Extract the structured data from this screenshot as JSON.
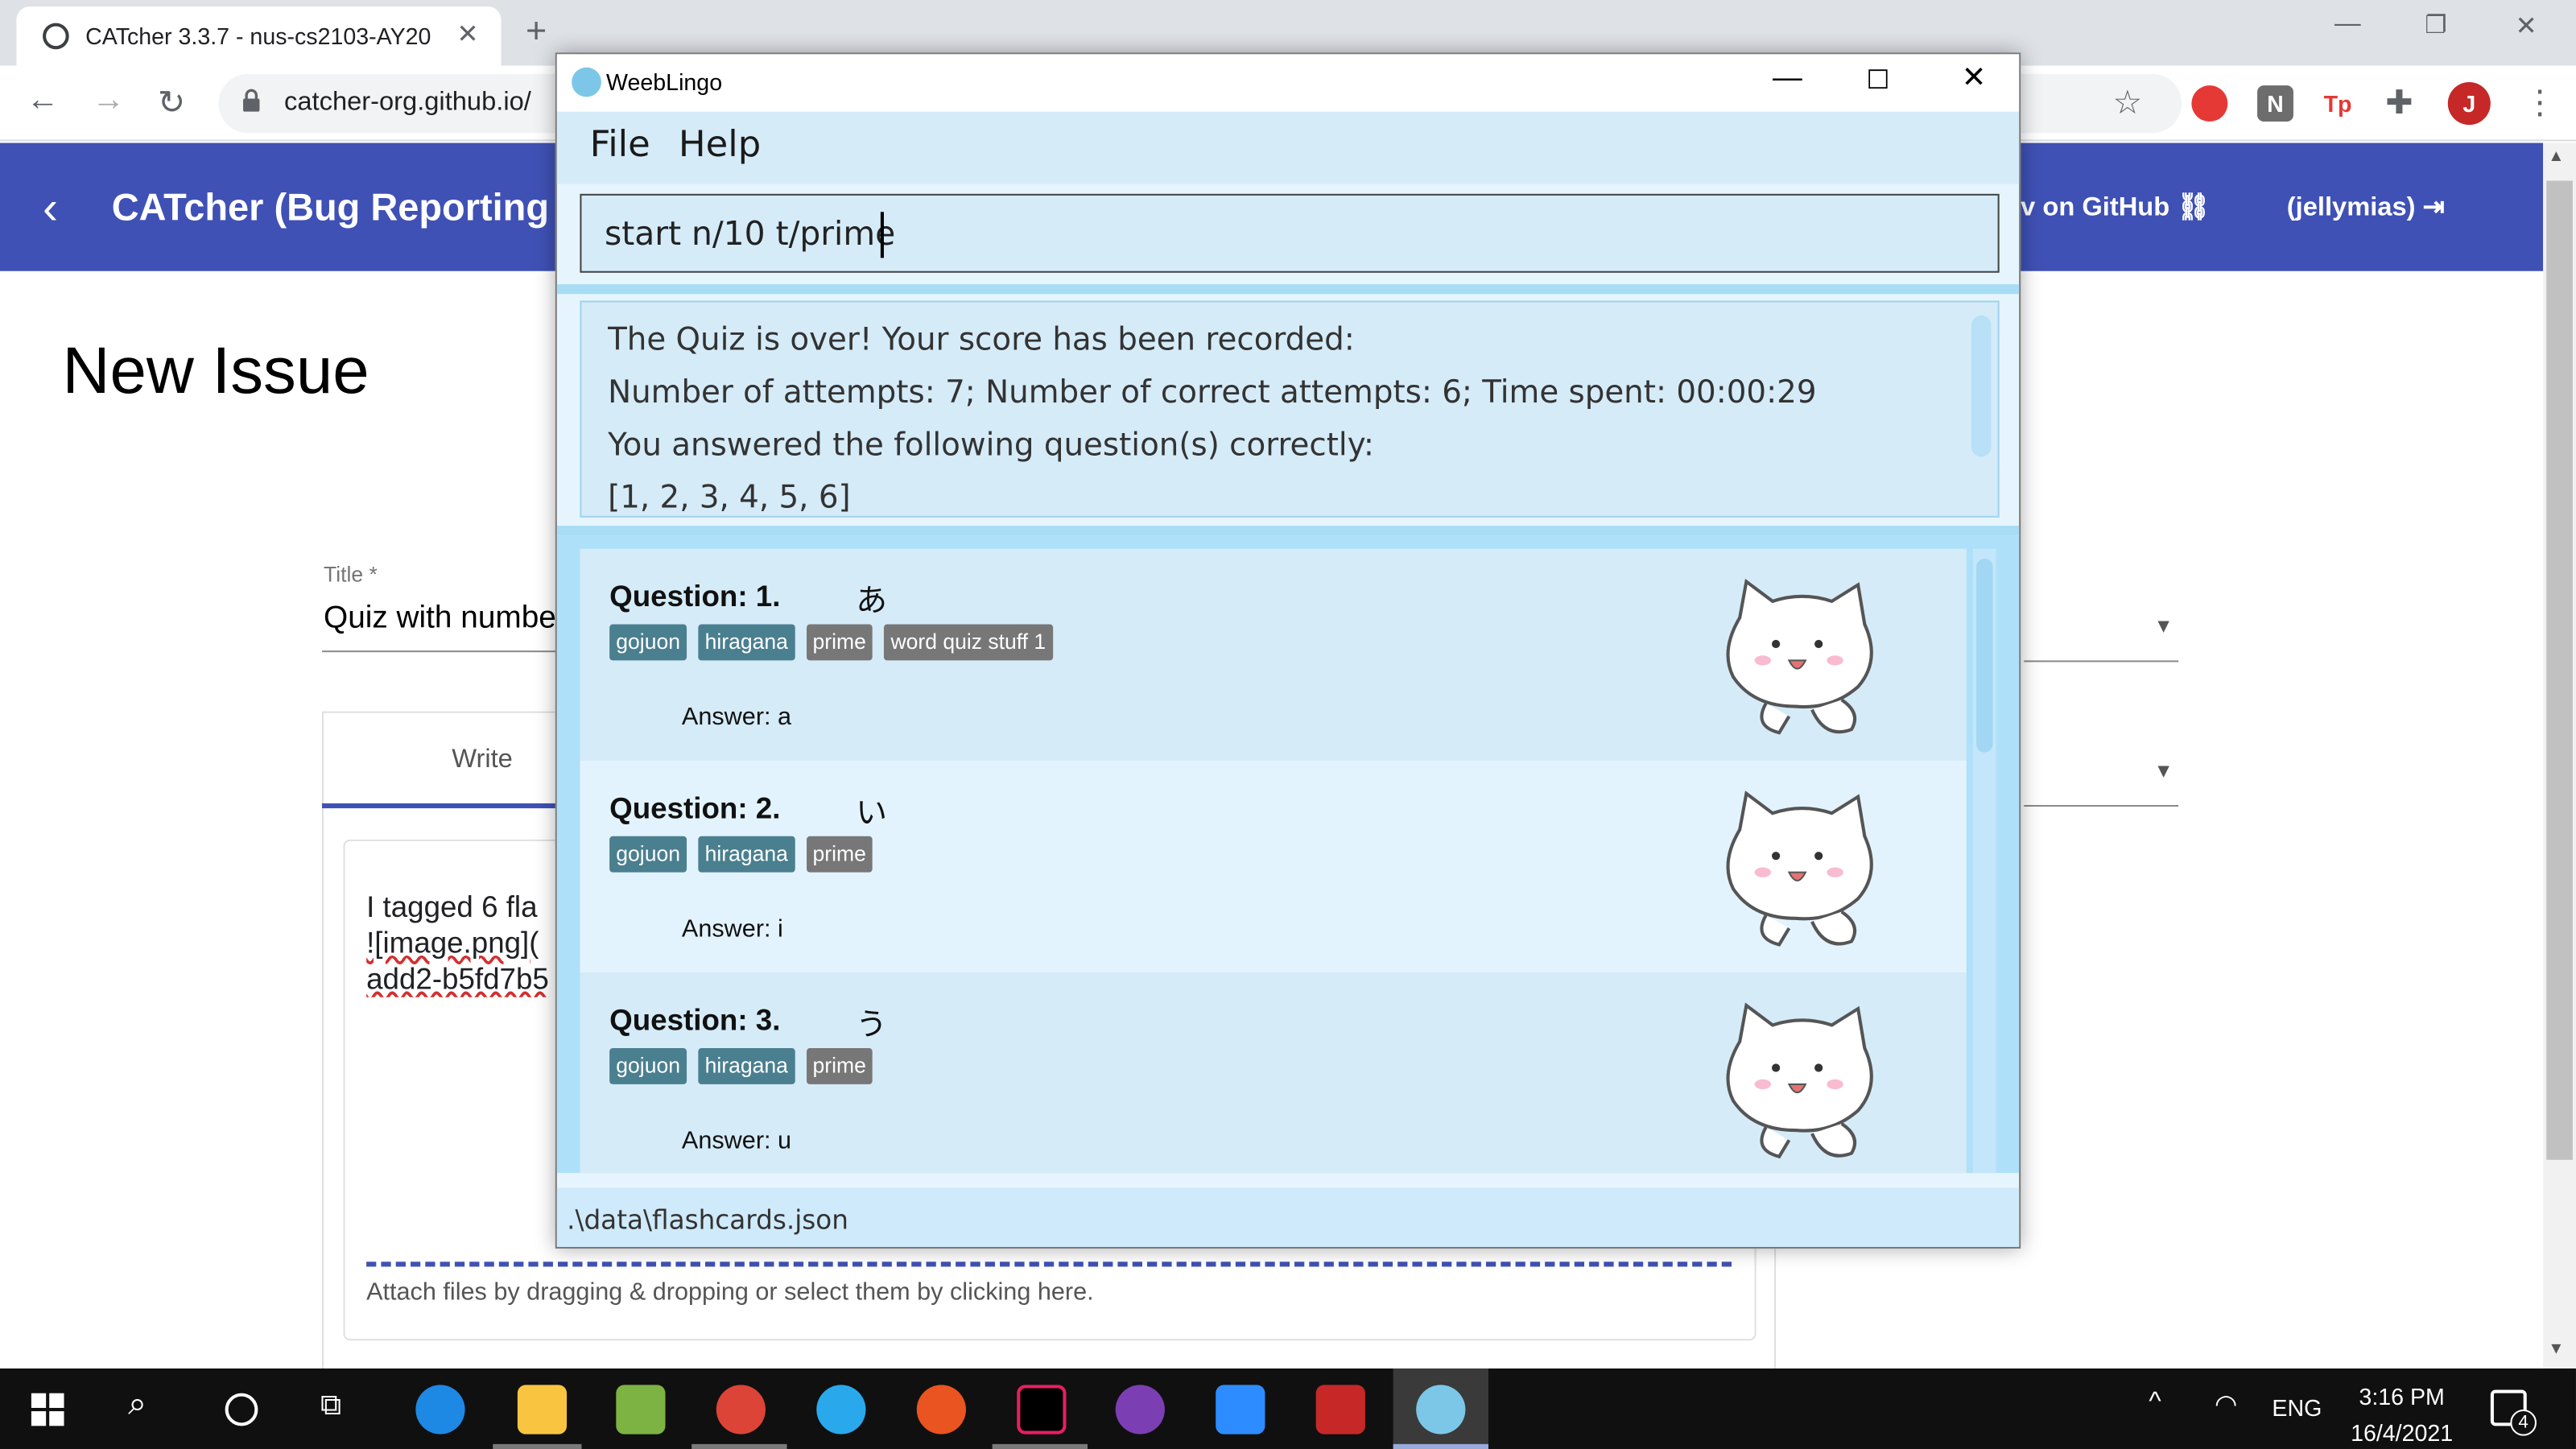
{
  "browser": {
    "tab_title": "CATcher 3.3.7 - nus-cs2103-AY20",
    "tab_close": "✕",
    "new_tab": "+",
    "url": "catcher-org.github.io/",
    "profile_initial": "J",
    "ext_n": "N",
    "ext_tp": "Tp"
  },
  "catcher": {
    "app_title": "CATcher  (Bug Reporting",
    "github_link": "v on GitHub",
    "user": "(jellymias)",
    "page_heading": "New Issue",
    "title_label": "Title *",
    "title_value": "Quiz with numbe",
    "write_tab": "Write",
    "body_lines": [
      "I tagged 6 fla",
      "![image.png](",
      "add2-b5fd7b5"
    ],
    "attach_hint": "Attach files by dragging & dropping or select them by clicking here."
  },
  "weeblingo": {
    "window_title": "WeebLingo",
    "menu": [
      "File",
      "Help"
    ],
    "command_input": "start n/10 t/prime",
    "result_lines": [
      "The Quiz is over! Your score has been recorded:",
      "Number of attempts: 7; Number of correct attempts: 6; Time spent: 00:00:29",
      "You answered the following question(s) correctly:",
      "[1, 2, 3, 4, 5, 6]"
    ],
    "cards": [
      {
        "question": "Question: 1.",
        "kana": "あ",
        "tags": [
          "gojuon",
          "hiragana",
          "prime",
          "word quiz stuff 1"
        ],
        "answer": "Answer: a"
      },
      {
        "question": "Question: 2.",
        "kana": "い",
        "tags": [
          "gojuon",
          "hiragana",
          "prime"
        ],
        "answer": "Answer: i"
      },
      {
        "question": "Question: 3.",
        "kana": "う",
        "tags": [
          "gojuon",
          "hiragana",
          "prime"
        ],
        "answer": "Answer: u"
      }
    ],
    "status_path": ".\\data\\flashcards.json"
  },
  "taskbar": {
    "lang": "ENG",
    "time": "3:16 PM",
    "date": "16/4/2021",
    "notif_count": "4"
  }
}
